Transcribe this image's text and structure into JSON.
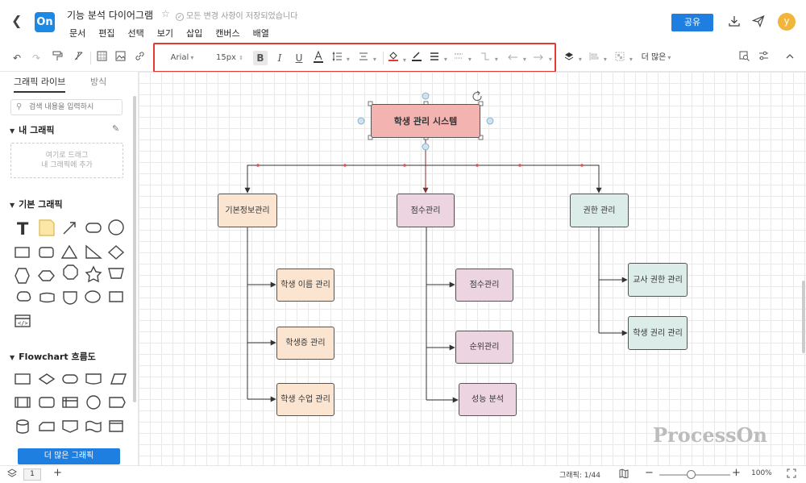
{
  "header": {
    "title": "기능 분석 다이어그램",
    "save_status": "모든 변경 사항이 저장되었습니다",
    "logo_text": "On",
    "share_label": "공유",
    "avatar_initial": "y",
    "menu": [
      "문서",
      "편집",
      "선택",
      "보기",
      "삽입",
      "캔버스",
      "배열"
    ]
  },
  "toolbar": {
    "font_family": "Arial",
    "font_size": "15px",
    "more_label": "더 많은"
  },
  "left_panel": {
    "tabs": [
      "그래픽 라이브",
      "방식"
    ],
    "search_placeholder": "검색 내용을 입력하시",
    "my_shapes_title": "내 그래픽",
    "drop_zone_line1": "여기로 드래그",
    "drop_zone_line2": "내 그래픽에 추가",
    "basic_title": "기본 그래픽",
    "flowchart_title": "Flowchart 흐름도",
    "more_shapes_label": "더 많은 그래픽"
  },
  "diagram": {
    "root": "학생 관리 시스템",
    "branches": [
      {
        "label": "기본정보관리",
        "children": [
          "학생 이름 관리",
          "학생증 관리",
          "학생 수업 관리"
        ]
      },
      {
        "label": "점수관리",
        "children": [
          "점수관리",
          "순위관리",
          "성능 분석"
        ]
      },
      {
        "label": "권한 관리",
        "children": [
          "교사 권한 관리",
          "학생 권리 관리"
        ]
      }
    ],
    "colors": {
      "root_fill": "#f3b3b0",
      "branch1_fill": "#fbe5d1",
      "branch2_fill": "#ecd5e0",
      "branch3_fill": "#dcece9"
    }
  },
  "watermark": "ProcessOn",
  "statusbar": {
    "page_number": "1",
    "shape_count": "그래픽: 1/44",
    "zoom": "100%"
  }
}
